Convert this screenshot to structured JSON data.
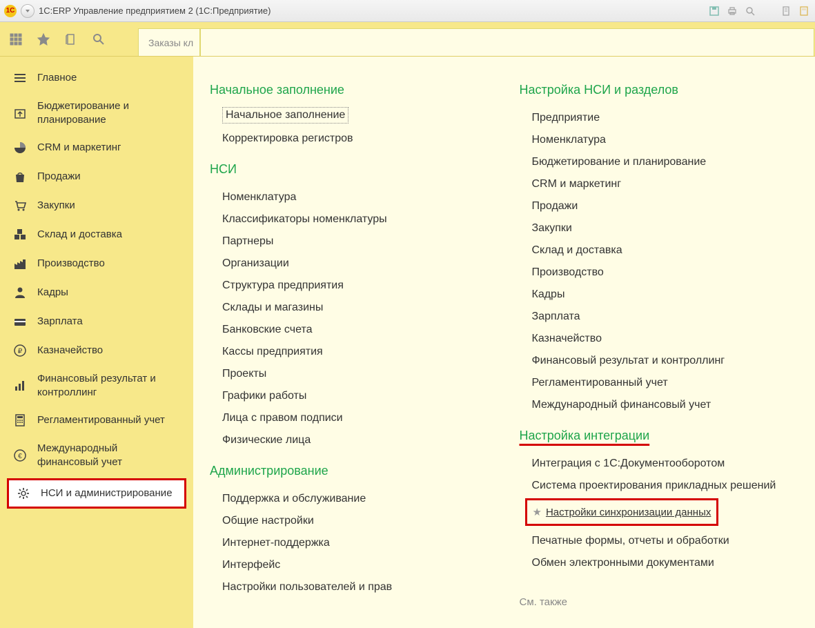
{
  "titlebar": {
    "title": "1С:ERP Управление предприятием 2  (1С:Предприятие)"
  },
  "toolbar": {
    "tab_truncated": "Заказы кл"
  },
  "sidebar": {
    "items": [
      {
        "label": "Главное",
        "name": "home",
        "icon": "menu"
      },
      {
        "label": "Бюджетирование и планирование",
        "name": "budgeting",
        "icon": "calendar-up",
        "multi": true
      },
      {
        "label": "CRM и маркетинг",
        "name": "crm",
        "icon": "pie"
      },
      {
        "label": "Продажи",
        "name": "sales",
        "icon": "bag"
      },
      {
        "label": "Закупки",
        "name": "purchases",
        "icon": "cart"
      },
      {
        "label": "Склад и доставка",
        "name": "warehouse",
        "icon": "boxes"
      },
      {
        "label": "Производство",
        "name": "production",
        "icon": "factory"
      },
      {
        "label": "Кадры",
        "name": "hr",
        "icon": "person"
      },
      {
        "label": "Зарплата",
        "name": "salary",
        "icon": "card"
      },
      {
        "label": "Казначейство",
        "name": "treasury",
        "icon": "ruble"
      },
      {
        "label": "Финансовый результат и контроллинг",
        "name": "finance",
        "icon": "bars",
        "multi": true
      },
      {
        "label": "Регламентированный учет",
        "name": "accounting",
        "icon": "calc"
      },
      {
        "label": "Международный финансовый учет",
        "name": "ifrs",
        "icon": "euro",
        "multi": true
      },
      {
        "label": "НСИ и администрирование",
        "name": "nsi-admin",
        "icon": "gear",
        "active": true,
        "multi": true
      }
    ]
  },
  "content": {
    "left": [
      {
        "title": "Начальное заполнение",
        "name": "initial-fill",
        "links": [
          {
            "label": "Начальное заполнение",
            "name": "initial-fill-link",
            "dotted": true
          },
          {
            "label": "Корректировка регистров",
            "name": "register-correction"
          }
        ]
      },
      {
        "title": "НСИ",
        "name": "nsi",
        "links": [
          {
            "label": "Номенклатура",
            "name": "nomenclature"
          },
          {
            "label": "Классификаторы номенклатуры",
            "name": "nomenclature-classifiers"
          },
          {
            "label": "Партнеры",
            "name": "partners"
          },
          {
            "label": "Организации",
            "name": "organizations"
          },
          {
            "label": "Структура предприятия",
            "name": "enterprise-structure"
          },
          {
            "label": "Склады и магазины",
            "name": "warehouses-stores"
          },
          {
            "label": "Банковские счета",
            "name": "bank-accounts"
          },
          {
            "label": "Кассы предприятия",
            "name": "cash-registers"
          },
          {
            "label": "Проекты",
            "name": "projects"
          },
          {
            "label": "Графики работы",
            "name": "work-schedules"
          },
          {
            "label": "Лица с правом подписи",
            "name": "signatories"
          },
          {
            "label": "Физические лица",
            "name": "individuals"
          }
        ]
      },
      {
        "title": "Администрирование",
        "name": "administration",
        "links": [
          {
            "label": "Поддержка и обслуживание",
            "name": "support"
          },
          {
            "label": "Общие настройки",
            "name": "general-settings"
          },
          {
            "label": "Интернет-поддержка",
            "name": "internet-support"
          },
          {
            "label": "Интерфейс",
            "name": "interface"
          },
          {
            "label": "Настройки пользователей и прав",
            "name": "user-settings"
          }
        ]
      }
    ],
    "right": [
      {
        "title": "Настройка НСИ и разделов",
        "name": "nsi-sections",
        "links": [
          {
            "label": "Предприятие",
            "name": "enterprise"
          },
          {
            "label": "Номенклатура",
            "name": "nomenclature-r"
          },
          {
            "label": "Бюджетирование и планирование",
            "name": "budgeting-r"
          },
          {
            "label": "CRM и маркетинг",
            "name": "crm-r"
          },
          {
            "label": "Продажи",
            "name": "sales-r"
          },
          {
            "label": "Закупки",
            "name": "purchases-r"
          },
          {
            "label": "Склад и доставка",
            "name": "warehouse-r"
          },
          {
            "label": "Производство",
            "name": "production-r"
          },
          {
            "label": "Кадры",
            "name": "hr-r"
          },
          {
            "label": "Зарплата",
            "name": "salary-r"
          },
          {
            "label": "Казначейство",
            "name": "treasury-r"
          },
          {
            "label": "Финансовый результат и контроллинг",
            "name": "finance-r"
          },
          {
            "label": "Регламентированный учет",
            "name": "accounting-r"
          },
          {
            "label": "Международный финансовый учет",
            "name": "ifrs-r"
          }
        ]
      },
      {
        "title": "Настройка интеграции",
        "name": "integration",
        "highlighted": true,
        "links": [
          {
            "label": "Интеграция с 1С:Документооборотом",
            "name": "doc-flow"
          },
          {
            "label": "Система проектирования прикладных решений",
            "name": "design-system"
          },
          {
            "label": "Настройки синхронизации данных",
            "name": "sync-settings",
            "boxed": true,
            "star": true
          },
          {
            "label": "Печатные формы, отчеты и обработки",
            "name": "print-forms"
          },
          {
            "label": "Обмен электронными документами",
            "name": "edoc-exchange"
          }
        ]
      }
    ],
    "see_also": "См. также"
  }
}
